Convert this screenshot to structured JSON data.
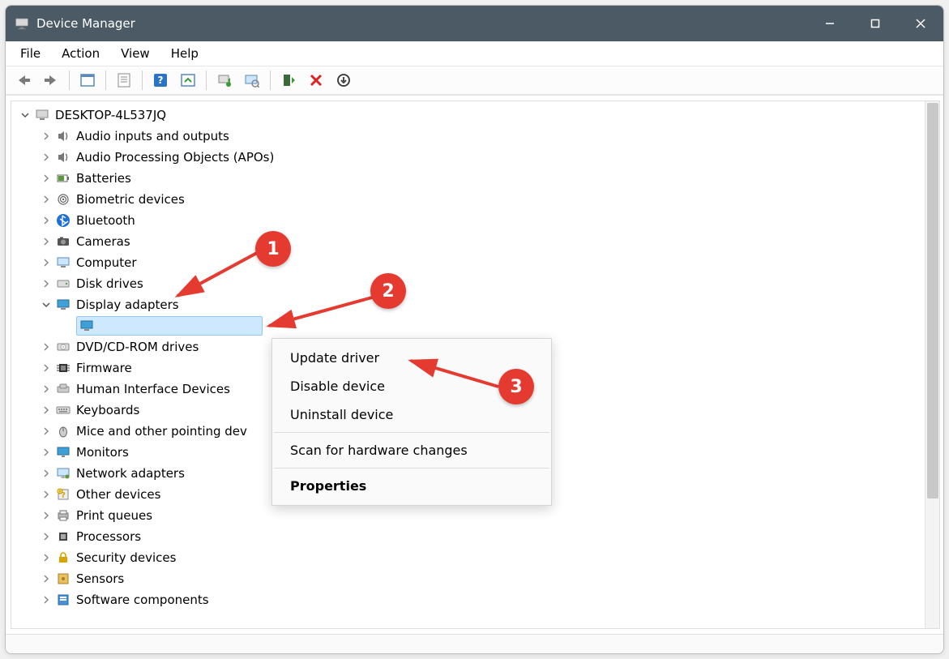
{
  "window": {
    "title": "Device Manager"
  },
  "menubar": {
    "file": "File",
    "action": "Action",
    "view": "View",
    "help": "Help"
  },
  "toolbar_icons": {
    "back": "back-arrow-icon",
    "forward": "forward-arrow-icon",
    "show_hidden": "show-hidden-icon",
    "properties": "properties-icon",
    "help": "help-icon",
    "refresh": "refresh-icon",
    "update": "update-driver-icon",
    "scan": "scan-hardware-icon",
    "enable": "enable-device-icon",
    "disable": "disable-device-icon",
    "uninstall": "uninstall-device-icon"
  },
  "tree": {
    "root": "DESKTOP-4L537JQ",
    "categories": [
      {
        "label": "Audio inputs and outputs",
        "icon": "speaker-icon"
      },
      {
        "label": "Audio Processing Objects (APOs)",
        "icon": "speaker-icon"
      },
      {
        "label": "Batteries",
        "icon": "battery-icon"
      },
      {
        "label": "Biometric devices",
        "icon": "fingerprint-icon"
      },
      {
        "label": "Bluetooth",
        "icon": "bluetooth-icon"
      },
      {
        "label": "Cameras",
        "icon": "camera-icon"
      },
      {
        "label": "Computer",
        "icon": "computer-icon"
      },
      {
        "label": "Disk drives",
        "icon": "disk-icon"
      },
      {
        "label": "Display adapters",
        "icon": "display-icon",
        "expanded": true,
        "children": [
          {
            "label": "",
            "icon": "display-icon",
            "selected": true
          }
        ]
      },
      {
        "label": "DVD/CD-ROM drives",
        "icon": "cdrom-icon"
      },
      {
        "label": "Firmware",
        "icon": "chip-icon"
      },
      {
        "label": "Human Interface Devices",
        "icon": "hid-icon"
      },
      {
        "label": "Keyboards",
        "icon": "keyboard-icon"
      },
      {
        "label": "Mice and other pointing dev",
        "icon": "mouse-icon"
      },
      {
        "label": "Monitors",
        "icon": "monitor-icon"
      },
      {
        "label": "Network adapters",
        "icon": "network-icon"
      },
      {
        "label": "Other devices",
        "icon": "unknown-icon"
      },
      {
        "label": "Print queues",
        "icon": "printer-icon"
      },
      {
        "label": "Processors",
        "icon": "cpu-icon"
      },
      {
        "label": "Security devices",
        "icon": "lock-icon"
      },
      {
        "label": "Sensors",
        "icon": "sensor-icon"
      },
      {
        "label": "Software components",
        "icon": "software-icon"
      }
    ]
  },
  "context_menu": {
    "update": "Update driver",
    "disable": "Disable device",
    "uninstall": "Uninstall device",
    "scan": "Scan for hardware changes",
    "properties": "Properties"
  },
  "annotations": {
    "1": "1",
    "2": "2",
    "3": "3"
  }
}
